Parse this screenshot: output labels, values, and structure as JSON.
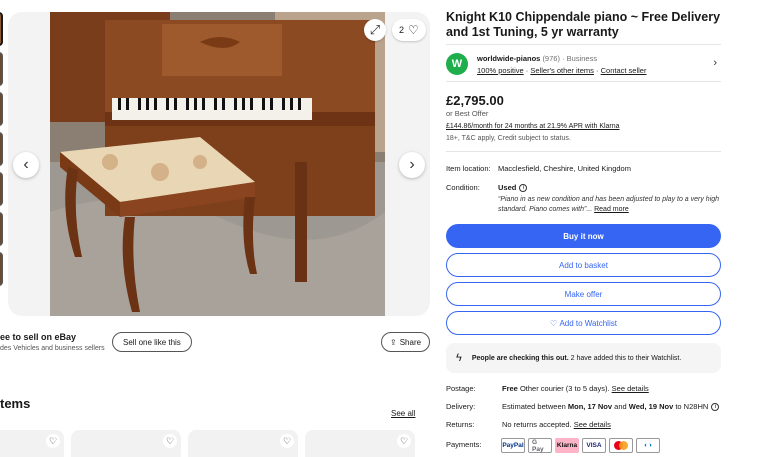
{
  "listing": {
    "title": "Knight K10 Chippendale piano ~ Free Delivery and 1st Tuning, 5 yr warranty",
    "price": "£2,795.00",
    "best_offer": "or Best Offer",
    "finance_link": "£144.86/month for 24 months at 21.9% APR with Klarna",
    "finance_note": "18+, T&C apply, Credit subject to status."
  },
  "gallery": {
    "watch_count": "2",
    "photo_alt": "Knight K10 Chippendale upright piano with stool"
  },
  "seller": {
    "avatar_letter": "W",
    "name": "worldwide-pianos",
    "feedback_count": "(976)",
    "separator": "·",
    "type": "Business",
    "positive": "100% positive",
    "other_items": "Seller's other items",
    "contact": "Contact seller"
  },
  "details": {
    "location_label": "Item location:",
    "location_value": "Macclesfield, Cheshire, United Kingdom",
    "condition_label": "Condition:",
    "condition_value": "Used",
    "condition_desc": "“Piano in as new condition and has been adjusted to play to a very high standard. Piano comes with”...",
    "read_more": "Read more"
  },
  "buttons": {
    "buy_now": "Buy it now",
    "add_basket": "Add to basket",
    "make_offer": "Make offer",
    "add_watchlist": "Add to Watchlist"
  },
  "alert": {
    "bold": "People are checking this out.",
    "rest": "2 have added this to their Watchlist."
  },
  "shipping": {
    "postage_label": "Postage:",
    "postage_free": "Free",
    "postage_rest": "Other courier (3 to 5 days).",
    "postage_link": "See details",
    "delivery_label": "Delivery:",
    "delivery_pre": "Estimated between",
    "delivery_start": "Mon, 17 Nov",
    "delivery_and": "and",
    "delivery_end": "Wed, 19 Nov",
    "delivery_post": "to N28HN",
    "returns_label": "Returns:",
    "returns_value": "No returns accepted.",
    "returns_link": "See details",
    "payments_label": "Payments:"
  },
  "payments": {
    "paypal": "PayPal",
    "gpay": "G Pay",
    "klarna": "Klarna",
    "visa": "VISA"
  },
  "sell": {
    "title": "ee to sell on eBay",
    "subtitle": "des Vehicles and business sellers",
    "sell_button": "Sell one like this",
    "share_button": "Share"
  },
  "recommended": {
    "heading": "tems",
    "see_all": "See all"
  },
  "colors": {
    "accent": "#3665f3",
    "seller_avatar": "#1fae4b",
    "klarna_pink": "#ffb3c7"
  }
}
